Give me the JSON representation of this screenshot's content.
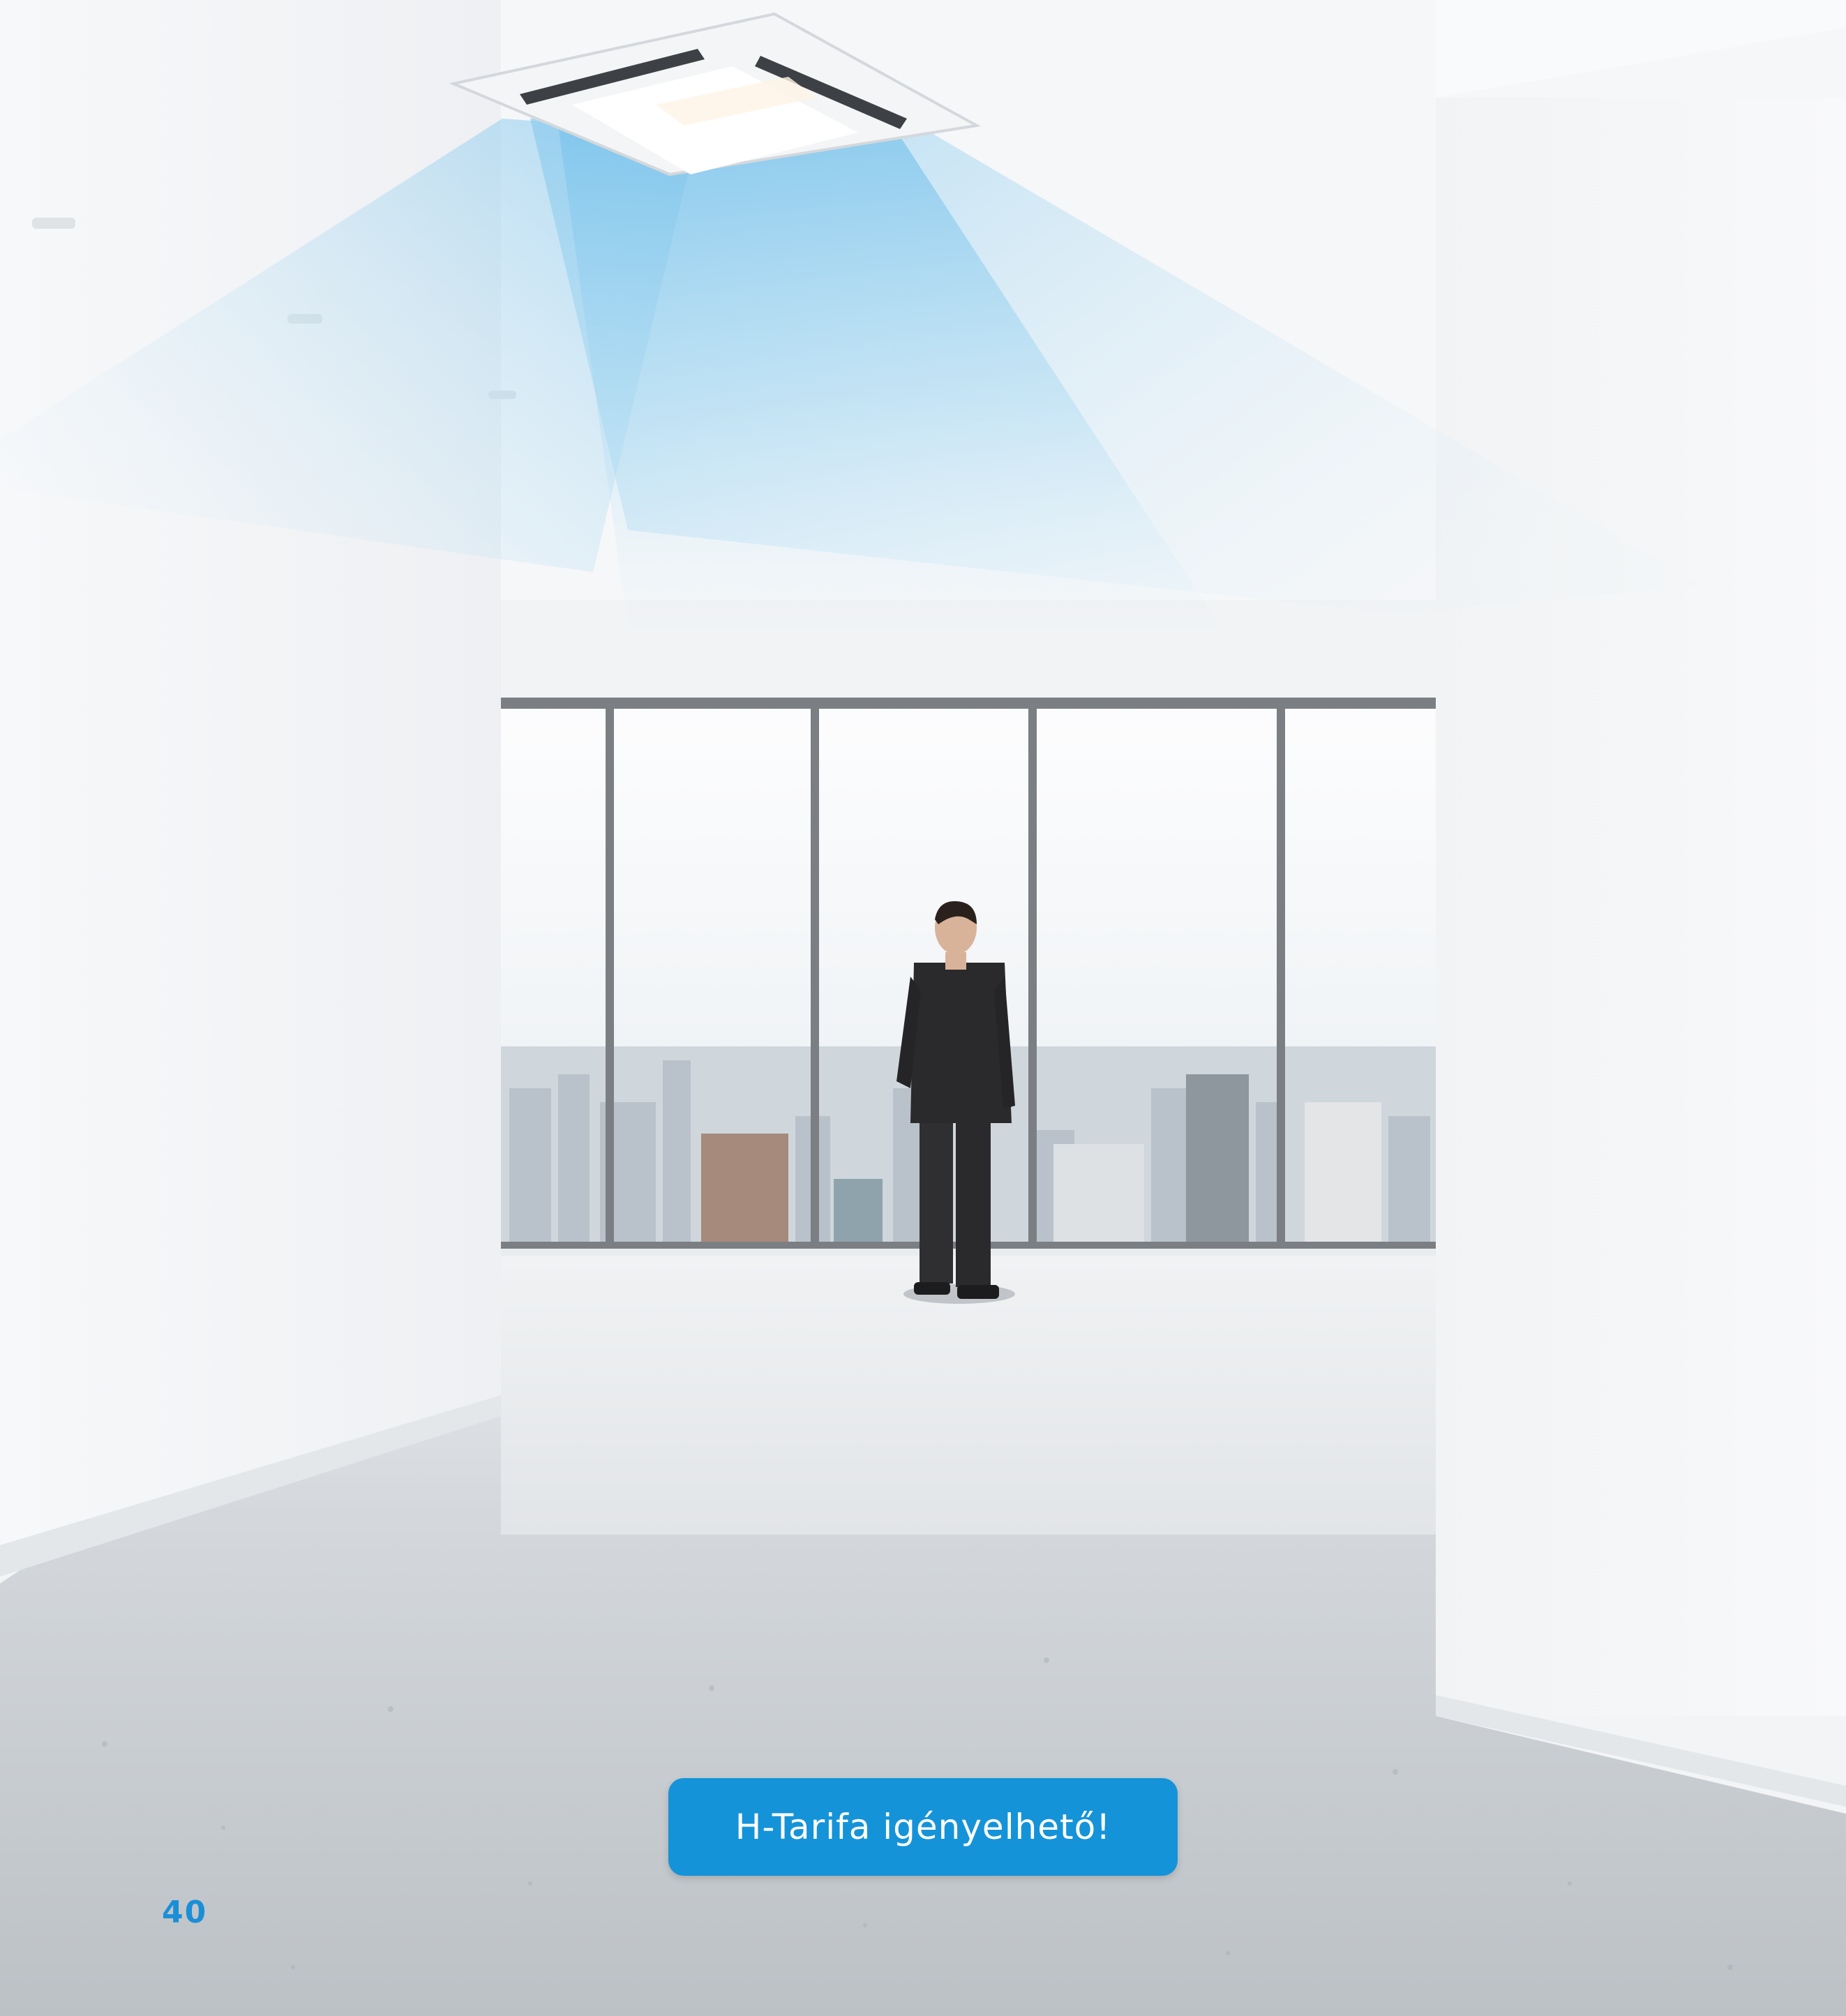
{
  "badge": {
    "text": "H-Tarifa igényelhető!",
    "background_color": "#1593d8",
    "text_color": "#ffffff"
  },
  "page_number": {
    "text": "40",
    "color": "#1b8fd6"
  },
  "scene": {
    "subject": "office interior with ceiling cassette air conditioner and man looking at city skyline",
    "airflow_color": "#8fd0f0",
    "wall_color": "#f5f6f8",
    "floor_color": "#c3c7cb",
    "window_frame_color": "#7b7f83",
    "suit_color": "#2a2a2c"
  }
}
